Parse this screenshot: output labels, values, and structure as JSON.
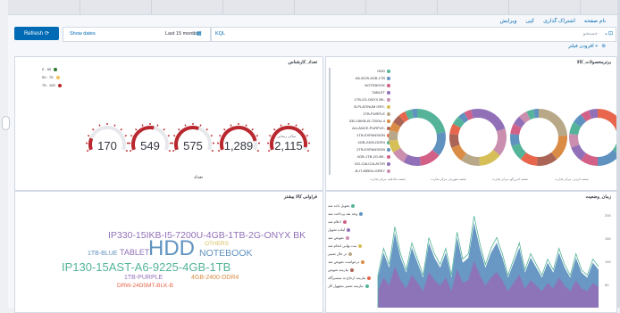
{
  "menu": [
    "نام صفحه",
    "اشتراک گذاری",
    "کپی",
    "ویرایش"
  ],
  "query": {
    "refresh_label": "Refresh",
    "refresh_icon": "refresh-icon",
    "show_dates": "Show dates",
    "time_value": "Last 15 months",
    "kql": "KQL",
    "search_placeholder": "جستجو"
  },
  "filter": {
    "label": "+ افزودن فیلتر"
  },
  "panels": {
    "brands": {
      "title": "برترمحصولات_کالا",
      "legend": [
        {
          "label": "HDD",
          "color": "#54b399"
        },
        {
          "label": "A6-9225-4GB-1TB",
          "color": "#6092c0"
        },
        {
          "label": "NOTEBOOK",
          "color": "#d36086"
        },
        {
          "label": "TABLET",
          "color": "#9170b8"
        },
        {
          "label": "1TB-2G-ONYX BK-",
          "color": "#ca8eae"
        },
        {
          "label": "B-PLATINUM GRY-",
          "color": "#d6bf57"
        },
        {
          "label": "1TB-PURPLE",
          "color": "#b9a888"
        },
        {
          "label": "330-15IKB-I5-7200U-4",
          "color": "#da8b45"
        },
        {
          "label": "ALLANCE-PURPLE-",
          "color": "#aa6556"
        },
        {
          "label": "1TB-EXPANSION",
          "color": "#e7664c"
        },
        {
          "label": "4GB-2400-DDR4",
          "color": "#54b399"
        },
        {
          "label": "2TB-EXPANSION",
          "color": "#6092c0"
        },
        {
          "label": "4GB-1TB-2G-BK-",
          "color": "#d36086"
        },
        {
          "label": "DG-CALCULATOR",
          "color": "#9170b8"
        },
        {
          "label": "-B-IT-8550U-GREY",
          "color": "#ca8eae"
        }
      ],
      "donut_captions": [
        "شعبه جردن- مرکز تجارت",
        "شعبه اندرزگو- مرکز تجارت",
        "شعبه شهریار- مرکز تجارت",
        "شعبه صادقیه- مرکز تجارت"
      ]
    },
    "gauges": {
      "title": "تعداد_کارشناس",
      "ranges": [
        {
          "label": "0 - 50",
          "color": "#2e7d32"
        },
        {
          "label": "50 - 75",
          "color": "#f0c35a"
        },
        {
          "label": "75 - 100",
          "color": "#b9282e"
        }
      ],
      "values": [
        "170",
        "549",
        "575",
        "1,289",
        "2,115"
      ],
      "sublabel": "سالی رسانی",
      "axis_title": "تعداد"
    },
    "wordcloud": {
      "title": "فراوانی کالا بیشتر",
      "words": [
        {
          "text": "IP330-15IKB-I5-7200U-4GB-1TB-2G-ONYX BK",
          "color": "#9170b8"
        },
        {
          "text": "OTHERS",
          "color": "#d6bf57"
        },
        {
          "text": "1TB-BLUE",
          "color": "#6092c0"
        },
        {
          "text": "TABLET",
          "color": "#9170b8"
        },
        {
          "text": "HDD",
          "color": "#6092c0"
        },
        {
          "text": "NOTEBOOK",
          "color": "#6092c0"
        },
        {
          "text": "IP130-15AST-A6-9225-4GB-1TB",
          "color": "#54b399"
        },
        {
          "text": "1TB-PURPLE",
          "color": "#9170b8"
        },
        {
          "text": "4GB-2400-DDR4",
          "color": "#da8b45"
        },
        {
          "text": "DRW-24D5MT-BLK-B",
          "color": "#e7664c"
        }
      ]
    },
    "status": {
      "title": "زمان_وضعیت",
      "legend": [
        {
          "label": "تحویل داده شد",
          "color": "#54b399"
        },
        {
          "label": "وجه نقد پرداخت شد",
          "color": "#6092c0"
        },
        {
          "label": "اعلام شد",
          "color": "#d36086"
        },
        {
          "label": "آماده تحویل",
          "color": "#9170b8"
        },
        {
          "label": "تعویض شد",
          "color": "#ca8eae"
        },
        {
          "label": "ثبت نهایی انجام شد",
          "color": "#d6bf57"
        },
        {
          "label": "در حال تعمیر",
          "color": "#b9a888"
        },
        {
          "label": "درخواست تعویض شد",
          "color": "#da8b45"
        },
        {
          "label": "نیازمند تعویض",
          "color": "#aa6556"
        },
        {
          "label": "نیازمند ارجاع به نمسیرگاه",
          "color": "#e7664c"
        },
        {
          "label": "نیازمند تعمیر مجهول کار",
          "color": "#54b399"
        }
      ],
      "yticks": [
        "200",
        "150",
        "100",
        "50"
      ]
    }
  }
}
